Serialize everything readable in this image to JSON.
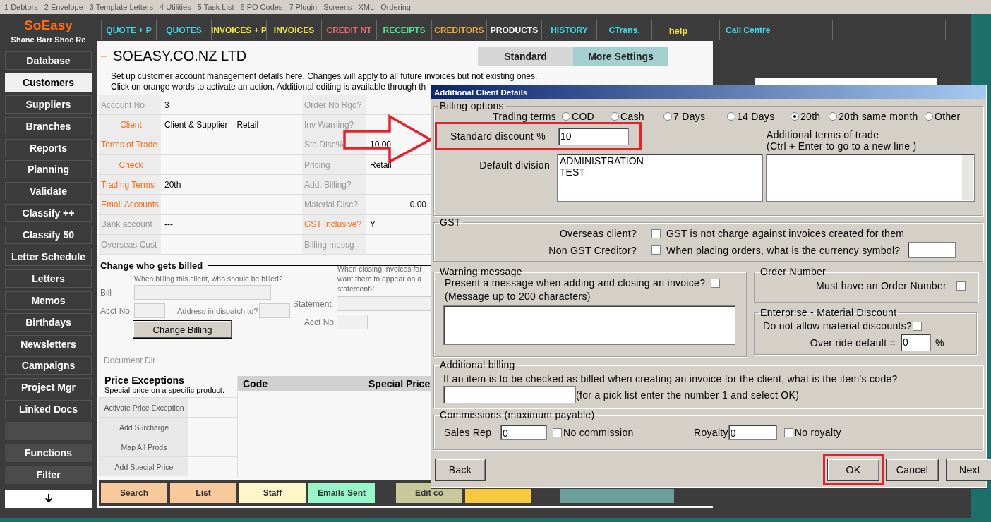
{
  "menu_bar": [
    "1 Debtors",
    "2 Envelope",
    "3 Template Letters",
    "4 Utilities",
    "5 Task List",
    "6 PO Codes",
    "7 Plugin",
    "Screens",
    "XML",
    "Ordering"
  ],
  "logo": {
    "title": "SoEasy",
    "subtitle": "Shane Barr Shoe Re"
  },
  "sidebar": [
    {
      "kind": "button",
      "label": "Database",
      "selected": false
    },
    {
      "kind": "button",
      "label": "Customers",
      "selected": true
    },
    {
      "kind": "button",
      "label": "Suppliers",
      "selected": false
    },
    {
      "kind": "button",
      "label": "Branches",
      "selected": false
    },
    {
      "kind": "button",
      "label": "Reports",
      "selected": false
    },
    {
      "kind": "button",
      "label": "Planning",
      "selected": false
    },
    {
      "kind": "button",
      "label": "Validate",
      "selected": false
    },
    {
      "kind": "button",
      "label": "Classify ++",
      "selected": false
    },
    {
      "kind": "button",
      "label": "Classify 50",
      "selected": false
    },
    {
      "kind": "button",
      "label": "Letter Schedule",
      "selected": false
    },
    {
      "kind": "button",
      "label": "Letters",
      "selected": false
    },
    {
      "kind": "button",
      "label": "Memos",
      "selected": false
    },
    {
      "kind": "button",
      "label": "Birthdays",
      "selected": false
    },
    {
      "kind": "button",
      "label": "Newsletters",
      "selected": false
    },
    {
      "kind": "button",
      "label": "Campaigns",
      "selected": false
    },
    {
      "kind": "button",
      "label": "Project Mgr",
      "selected": false
    },
    {
      "kind": "button",
      "label": "Linked Docs",
      "selected": false
    },
    {
      "kind": "blank"
    },
    {
      "kind": "action",
      "label": "Functions"
    },
    {
      "kind": "action",
      "label": "Filter"
    },
    {
      "kind": "arrow"
    }
  ],
  "nav": [
    {
      "label": "QUOTE + P",
      "color": "#3fd9ec"
    },
    {
      "label": "QUOTES",
      "color": "#3fd9ec"
    },
    {
      "label": "INVOICES + P",
      "color": "#f2e641"
    },
    {
      "label": "INVOICES",
      "color": "#f2e641"
    },
    {
      "label": "CREDIT NT",
      "color": "#e86a6a"
    },
    {
      "label": "RECEIPTS",
      "color": "#4fe38a"
    },
    {
      "label": "CREDITORS",
      "color": "#f2a93b"
    },
    {
      "label": "PRODUCTS",
      "color": "#ffffff"
    },
    {
      "label": "HISTORY",
      "color": "#3fd9ec"
    },
    {
      "label": "CTrans.",
      "color": "#3fd9ec"
    }
  ],
  "help": "help",
  "call_centre": {
    "label": "Call Centre"
  },
  "company": {
    "title": "SOEASY.CO.NZ LTD"
  },
  "tabs": [
    {
      "label": "Standard",
      "selected": false
    },
    {
      "label": "More Settings",
      "selected": true
    }
  ],
  "description": [
    "Set up customer account management details here. Changes will apply to all future invoices but not existing ones.",
    "Click on orange words to activate an action. Additional editing is available through th"
  ],
  "account_fields": [
    {
      "label": "Account No",
      "action": false,
      "values": [
        "3"
      ]
    },
    {
      "label": "Client",
      "action": true,
      "values": [
        "Client & Supplier",
        "Retail"
      ]
    },
    {
      "label": "Terms of Trade",
      "action": true
    },
    {
      "label": "Check",
      "action": true
    },
    {
      "label": "Trading Terms",
      "action": true,
      "values": [
        "20th"
      ]
    },
    {
      "label": "Email Accounts",
      "action": true
    },
    {
      "label": "Bank account",
      "action": false,
      "values": [
        "---"
      ]
    },
    {
      "label": "Overseas Cust",
      "action": false
    }
  ],
  "account_fields_2": [
    {
      "label": "Order No Rqd?",
      "action": false
    },
    {
      "label": "Inv Warning?",
      "action": false
    },
    {
      "label": "Std Disc%",
      "action": false,
      "value": "10.00"
    },
    {
      "label": "Pricing",
      "action": false,
      "value": "Retail"
    },
    {
      "label": "Add. Billing?",
      "action": false
    },
    {
      "label": "Material Disc?",
      "action": false,
      "value": "0.00",
      "numeric": true
    },
    {
      "label": "GST Inclusive?",
      "action": true,
      "value": "Y"
    },
    {
      "label": "Billing messg",
      "action": false
    }
  ],
  "billing": {
    "title": "Change who gets billed",
    "bill_hint": "When billing this client, who should be billed?",
    "bill_label": "Bill",
    "acct_label": "Acct No",
    "dispatch_label": "Address in dispatch to?",
    "change_button": "Change Billing",
    "statement_hint": [
      "When closing Invoices for",
      "want them to appear on a",
      "statement?"
    ],
    "statement_label": "Statement",
    "statement_acct_label": "Acct No"
  },
  "document_dir": "Document Dir",
  "price_exceptions": {
    "title": "Price Exceptions",
    "subtitle": "Special price on a specific product.",
    "actions": [
      "Activate Price Exception",
      "Add Surcharge",
      "Map All Prods",
      "Add Special Price"
    ],
    "columns": [
      "Code",
      "Special Price"
    ]
  },
  "bottom_buttons": [
    {
      "label": "Search",
      "color": "#f8c99a"
    },
    {
      "label": "List",
      "color": "#f8c99a"
    },
    {
      "label": "Staff",
      "color": "#fbf7c8"
    },
    {
      "label": "Emails Sent",
      "color": "#98f7c9"
    },
    {
      "label": "Edit co",
      "color": "#c9c89b"
    },
    {
      "color": "#f8c93e"
    },
    {
      "color": "#6a9f9b"
    }
  ],
  "dialog": {
    "title": "Additional Client Details",
    "billing_options": {
      "legend": "Billing options",
      "trading_terms_label": "Trading terms",
      "terms": [
        {
          "label": "COD",
          "selected": false
        },
        {
          "label": "Cash",
          "selected": false
        },
        {
          "label": "7 Days",
          "selected": false
        },
        {
          "label": "14 Days",
          "selected": false
        },
        {
          "label": "20th",
          "selected": true
        },
        {
          "label": "20th same month",
          "selected": false
        },
        {
          "label": "Other",
          "selected": false
        }
      ],
      "discount_label": "Standard discount %",
      "discount_value": "10",
      "discount_highlighted": true,
      "additional_terms_label": [
        "Additional terms of trade",
        "(Ctrl + Enter to go to a new line )"
      ],
      "division_label": "Default division",
      "divisions": [
        "ADMINISTRATION",
        "TEST"
      ]
    },
    "gst": {
      "legend": "GST",
      "rows": [
        {
          "label": "Overseas client?",
          "checked": false,
          "text": "GST is not charge against invoices created for them"
        },
        {
          "label": "Non GST Creditor?",
          "checked": false,
          "text": "When placing orders, what is the currency symbol?"
        }
      ]
    },
    "warning": {
      "legend": "Warning message",
      "question": "Present a message when adding and closing an invoice?",
      "checked": false,
      "note": "(Message up to 200 characters)"
    },
    "order_number": {
      "legend": "Order Number",
      "label": "Must have an Order Number",
      "checked": false
    },
    "material_discount": {
      "legend": "Enterprise - Material Discount",
      "label": "Do not allow material discounts?",
      "checked": false,
      "override_label": "Over ride default =",
      "override_value": "0",
      "unit": "%"
    },
    "additional_billing": {
      "legend": "Additional billing",
      "question": "If an item is to be checked as billed when creating an invoice for the client, what is the item's code?",
      "hint": "(for a pick list enter the number 1 and select OK)"
    },
    "commissions": {
      "legend": "Commissions (maximum payable)",
      "sales_rep_label": "Sales Rep",
      "sales_rep_value": "0",
      "no_commission": {
        "label": "No commission",
        "checked": false
      },
      "royalty_label": "Royalty",
      "royalty_value": "0",
      "no_royalty": {
        "label": "No royalty",
        "checked": false
      }
    },
    "buttons": [
      {
        "label": "Back",
        "highlighted": false
      },
      {
        "label": "OK",
        "highlighted": true
      },
      {
        "label": "Cancel",
        "highlighted": false
      },
      {
        "label": "Next",
        "highlighted": false
      }
    ]
  }
}
